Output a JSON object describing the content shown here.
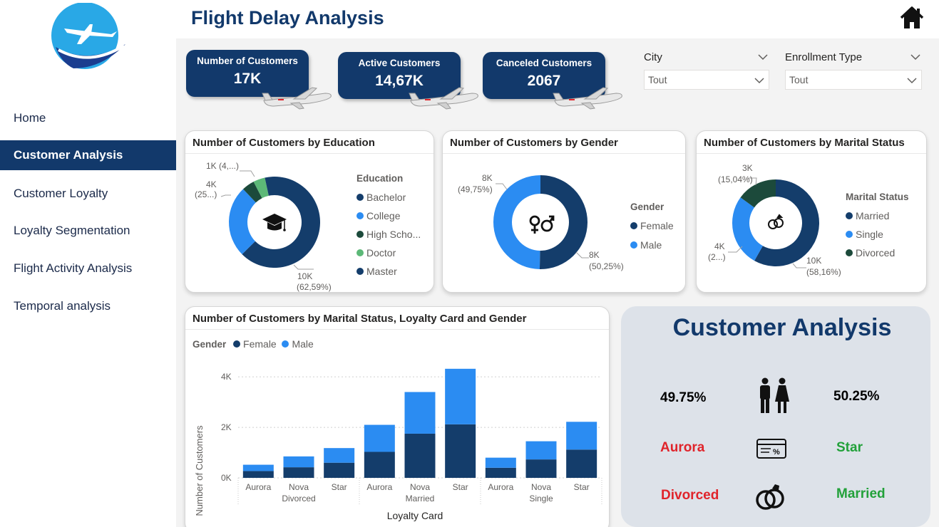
{
  "header": {
    "title": "Flight Delay Analysis"
  },
  "nav": [
    {
      "label": "Home",
      "active": false
    },
    {
      "label": "Customer Analysis",
      "active": true
    },
    {
      "label": "Customer Loyalty",
      "active": false
    },
    {
      "label": "Loyalty Segmentation",
      "active": false
    },
    {
      "label": "Flight Activity Analysis",
      "active": false
    },
    {
      "label": "Temporal analysis",
      "active": false
    }
  ],
  "kpis": [
    {
      "label": "Number of Customers",
      "value": "17K"
    },
    {
      "label": "Active Customers",
      "value": "14,67K"
    },
    {
      "label": "Canceled Customers",
      "value": "2067"
    }
  ],
  "slicers": [
    {
      "title": "City",
      "value": "Tout"
    },
    {
      "title": "Enrollment Type",
      "value": "Tout"
    }
  ],
  "colors": {
    "navy": "#12396b",
    "dark_blue": "#143d6b",
    "bright_blue": "#2b8cf2",
    "dark_green": "#1c4a3b",
    "light_green": "#5cb877",
    "red": "#e0242b",
    "green": "#22a13a"
  },
  "chart_data": [
    {
      "type": "pie",
      "title": "Number of Customers by Education",
      "legend_title": "Education",
      "categories": [
        "Bachelor",
        "College",
        "High Scho...",
        "Doctor",
        "Master"
      ],
      "values": [
        10475,
        4238,
        750,
        700,
        570
      ],
      "data_labels": [
        "10K (62,59%)",
        "4K (25...)",
        "1K (4,...)"
      ],
      "center_icon": "graduation-cap-icon",
      "legend_position": "right"
    },
    {
      "type": "pie",
      "title": "Number of Customers by Gender",
      "legend_title": "Gender",
      "categories": [
        "Female",
        "Male"
      ],
      "values": [
        8410,
        8327
      ],
      "data_labels": [
        "8K (50,25%)",
        "8K (49,75%)"
      ],
      "center_icon": "gender-icon",
      "legend_position": "right"
    },
    {
      "type": "pie",
      "title": "Number of Customers by Marital Status",
      "legend_title": "Marital Status",
      "categories": [
        "Married",
        "Single",
        "Divorced"
      ],
      "values": [
        9735,
        4484,
        2518
      ],
      "data_labels": [
        "10K (58,16%)",
        "4K (2...)",
        "3K (15,04%)"
      ],
      "center_icon": "rings-icon",
      "legend_position": "right"
    },
    {
      "type": "bar",
      "stacked": true,
      "title": "Number of Customers by Marital Status, Loyalty Card and Gender",
      "legend_title": "Gender",
      "legend_position": "top-left",
      "xlabel": "Loyalty Card",
      "ylabel": "Number of Customers",
      "groups": [
        "Divorced",
        "Married",
        "Single"
      ],
      "categories": [
        "Aurora",
        "Nova",
        "Star",
        "Aurora",
        "Nova",
        "Star",
        "Aurora",
        "Nova",
        "Star"
      ],
      "series": [
        {
          "name": "Female",
          "values": [
            270,
            420,
            600,
            1030,
            1750,
            2120,
            400,
            730,
            1120
          ]
        },
        {
          "name": "Male",
          "values": [
            250,
            430,
            580,
            1070,
            1650,
            2200,
            400,
            720,
            1100
          ]
        }
      ],
      "ylim": [
        0,
        4400
      ],
      "yticks": [
        0,
        2000,
        4000
      ],
      "ytick_labels": [
        "0K",
        "2K",
        "4K"
      ],
      "grid": true
    }
  ],
  "summary": {
    "title": "Customer Analysis",
    "female_pct": "49.75%",
    "male_pct": "50.25%",
    "card_low": "Aurora",
    "card_high": "Star",
    "status_low": "Divorced",
    "status_high": "Married"
  }
}
